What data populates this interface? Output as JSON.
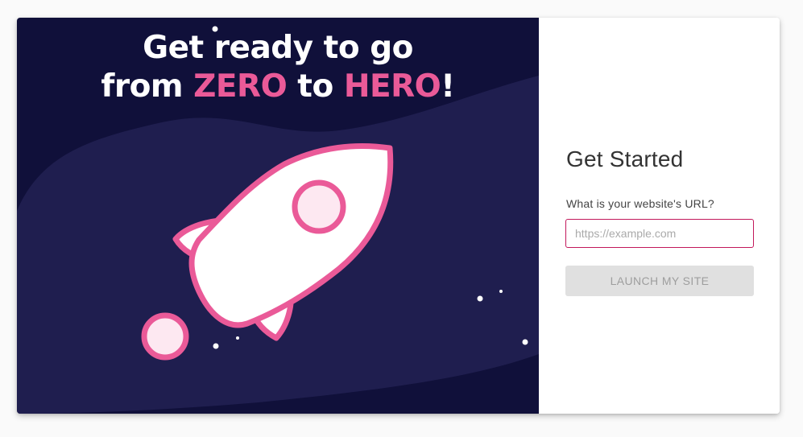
{
  "hero": {
    "headline_line1": "Get ready to go",
    "headline_from": "from ",
    "headline_zero": "ZERO",
    "headline_to": " to ",
    "headline_hero": "HERO",
    "headline_end": "!",
    "illustration": "rocket-icon"
  },
  "form": {
    "title": "Get Started",
    "url_label": "What is your website's URL?",
    "url_value": "",
    "url_placeholder": "https://example.com",
    "launch_label": "LAUNCH MY SITE"
  },
  "colors": {
    "hero_bg_dark": "#10103a",
    "hero_bg_wave": "#1f1e4f",
    "accent_pink": "#ea5a98",
    "input_border": "#c2185b",
    "button_disabled_bg": "#e0e0e0",
    "button_disabled_text": "#9e9e9e"
  }
}
